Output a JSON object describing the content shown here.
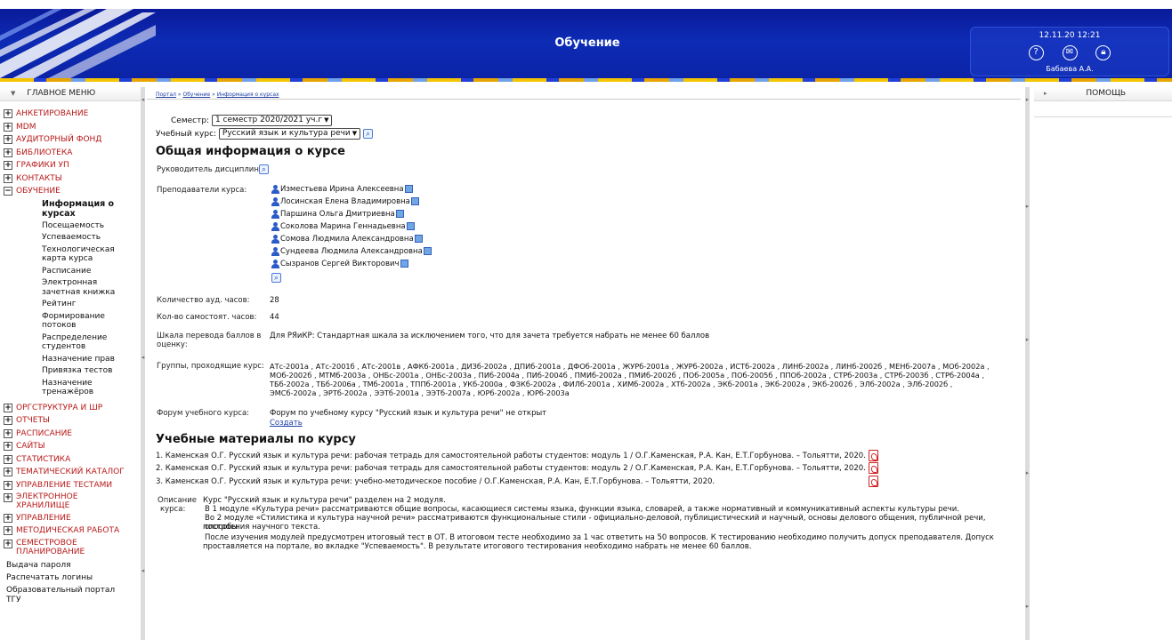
{
  "header": {
    "title": "Обучение",
    "datetime": "12.11.20 12:21",
    "user_name": "Бабаева А.А.",
    "icons": [
      "help-icon",
      "mail-icon",
      "lock-icon"
    ]
  },
  "left_menu": {
    "title": "ГЛАВНОЕ МЕНЮ",
    "items": [
      {
        "label": "АНКЕТИРОВАНИЕ",
        "expanded": false
      },
      {
        "label": "MDM",
        "expanded": false
      },
      {
        "label": "АУДИТОРНЫЙ ФОНД",
        "expanded": false
      },
      {
        "label": "БИБЛИОТЕКА",
        "expanded": false
      },
      {
        "label": "ГРАФИКИ УП",
        "expanded": false
      },
      {
        "label": "КОНТАКТЫ",
        "expanded": false
      },
      {
        "label": "ОБУЧЕНИЕ",
        "expanded": true
      }
    ],
    "training_sub": [
      "Информация о курсах",
      "Посещаемость",
      "Успеваемость",
      "Технологическая карта курса",
      "Расписание",
      "Электронная зачетная книжка",
      "Рейтинг",
      "Формирование потоков",
      "Распределение студентов",
      "Назначение прав",
      "Привязка тестов",
      "Назначение тренажёров"
    ],
    "items2": [
      "ОРГСТРУКТУРА И ШР",
      "ОТЧЕТЫ",
      "РАСПИСАНИЕ",
      "САЙТЫ",
      "СТАТИСТИКА",
      "ТЕМАТИЧЕСКИЙ КАТАЛОГ",
      "УПРАВЛЕНИЕ ТЕСТАМИ",
      "ЭЛЕКТРОННОЕ ХРАНИЛИЩЕ",
      "УПРАВЛЕНИЕ",
      "МЕТОДИЧЕСКАЯ РАБОТА",
      "СЕМЕСТРОВОЕ ПЛАНИРОВАНИЕ"
    ],
    "plain": [
      "Выдача пароля",
      "Распечатать логины",
      "Образовательный портал ТГУ"
    ]
  },
  "breadcrumb": [
    "Портал",
    "Обучение",
    "Информация о курсах"
  ],
  "filters": {
    "semester_label": "Семестр:",
    "semester_value": "1 семестр 2020/2021 уч.г",
    "course_label": "Учебный курс:",
    "course_value": "Русский язык и культура речи"
  },
  "general": {
    "heading": "Общая информация о курсе",
    "head_label": "Руководитель дисциплины:",
    "teachers_label": "Преподаватели курса:",
    "teachers": [
      "Изместьева Ирина Алексеевна",
      "Лосинская Елена Владимировна",
      "Паршина Ольга Дмитриевна",
      "Соколова Марина Геннадьевна",
      "Сомова Людмила Александровна",
      "Сундеева Людмила Александровна",
      "Сызранов Сергей Викторович"
    ],
    "aud_hours_label": "Количество ауд. часов:",
    "aud_hours": "28",
    "self_hours_label": "Кол-во самостоят. часов:",
    "self_hours": "44",
    "scale_label": "Шкала перевода баллов в оценку:",
    "scale_value": "Для РЯиКР: Стандартная шкала за исключением того, что для зачета требуется набрать не менее 60 баллов",
    "groups_label": "Группы, проходящие курс:",
    "groups_lines": [
      "АТс-2001а , АТс-2001б , АТс-2001в , АФКб-2001а , ДИЗб-2002а , ДПИб-2001а , ДФОб-2001а , ЖУРб-2001а , ЖУРб-2002а , ИСТб-2002а , ЛИНб-2002а , ЛИНб-2002б , МЕНб-2007а , МОб-2002а ,",
      "МОб-2002б , МТМб-2003а , ОНБс-2001а , ОНБс-2003а , ПИб-2004а , ПИб-2004б , ПМИб-2002а , ПМИб-2002б , ПОб-2005а , ПОб-2005б , ППОб-2002а , СТРб-2003а , СТРб-2003б , СТРб-2004а ,",
      "ТБб-2002а , ТБб-2006а , ТМб-2001а , ТППб-2001а , УКб-2000а , ФЗКб-2002а , ФИЛб-2001а , ХИМб-2002а , ХТб-2002а , ЭКб-2001а , ЭКб-2002а , ЭКб-2002б , ЭЛб-2002а , ЭЛб-2002б ,",
      "ЭМСб-2002а , ЭРТб-2002а , ЭЭТб-2001а , ЭЭТб-2007а , ЮРб-2002а , ЮРб-2003а"
    ],
    "forum_label": "Форум учебного курса:",
    "forum_value": "Форум по учебному курсу \"Русский язык и культура речи\" не открыт",
    "forum_create": "Создать"
  },
  "materials": {
    "heading": "Учебные материалы по курсу",
    "items": [
      "1. Каменская О.Г. Русский язык и культура речи: рабочая тетрадь для самостоятельной работы студентов: модуль 1 / О.Г.Каменская, Р.А. Кан, Е.Т.Горбунова. – Тольятти, 2020.",
      "2. Каменская О.Г. Русский язык и культура речи: рабочая тетрадь для самостоятельной работы студентов: модуль 2 / О.Г.Каменская, Р.А. Кан, Е.Т.Горбунова. – Тольятти, 2020.",
      "3. Каменская О.Г. Русский язык и культура речи: учебно-методическое пособие / О.Г.Каменская, Р.А. Кан, Е.Т.Горбунова. – Тольятти, 2020."
    ]
  },
  "description": {
    "label_1": "Описание",
    "label_2": "курса:",
    "lines": [
      "Курс \"Русский язык и культура речи\" разделен на 2 модуля.",
      "В 1 модуле «Культура речи» рассматриваются общие вопросы, касающиеся системы языка, функции языка, словарей, а также нормативный и коммуникативный аспекты культуры речи.",
      "Во 2 модуле «Стилистика и культура научной речи» рассматриваются функциональные стили - официально-деловой, публицистический и научный, основы делового общения, публичной речи, способы",
      "построения научного текста.",
      "После изучения модулей предусмотрен итоговый тест в ОТ. В итоговом тесте необходимо за 1 час ответить на 50 вопросов. К тестированию необходимо получить допуск преподавателя. Допуск",
      "проставляется на портале, во вкладке \"Успеваемость\". В результате итогового тестирования необходимо набрать не менее 60 баллов."
    ]
  },
  "help": {
    "title": "ПОМОЩЬ"
  }
}
